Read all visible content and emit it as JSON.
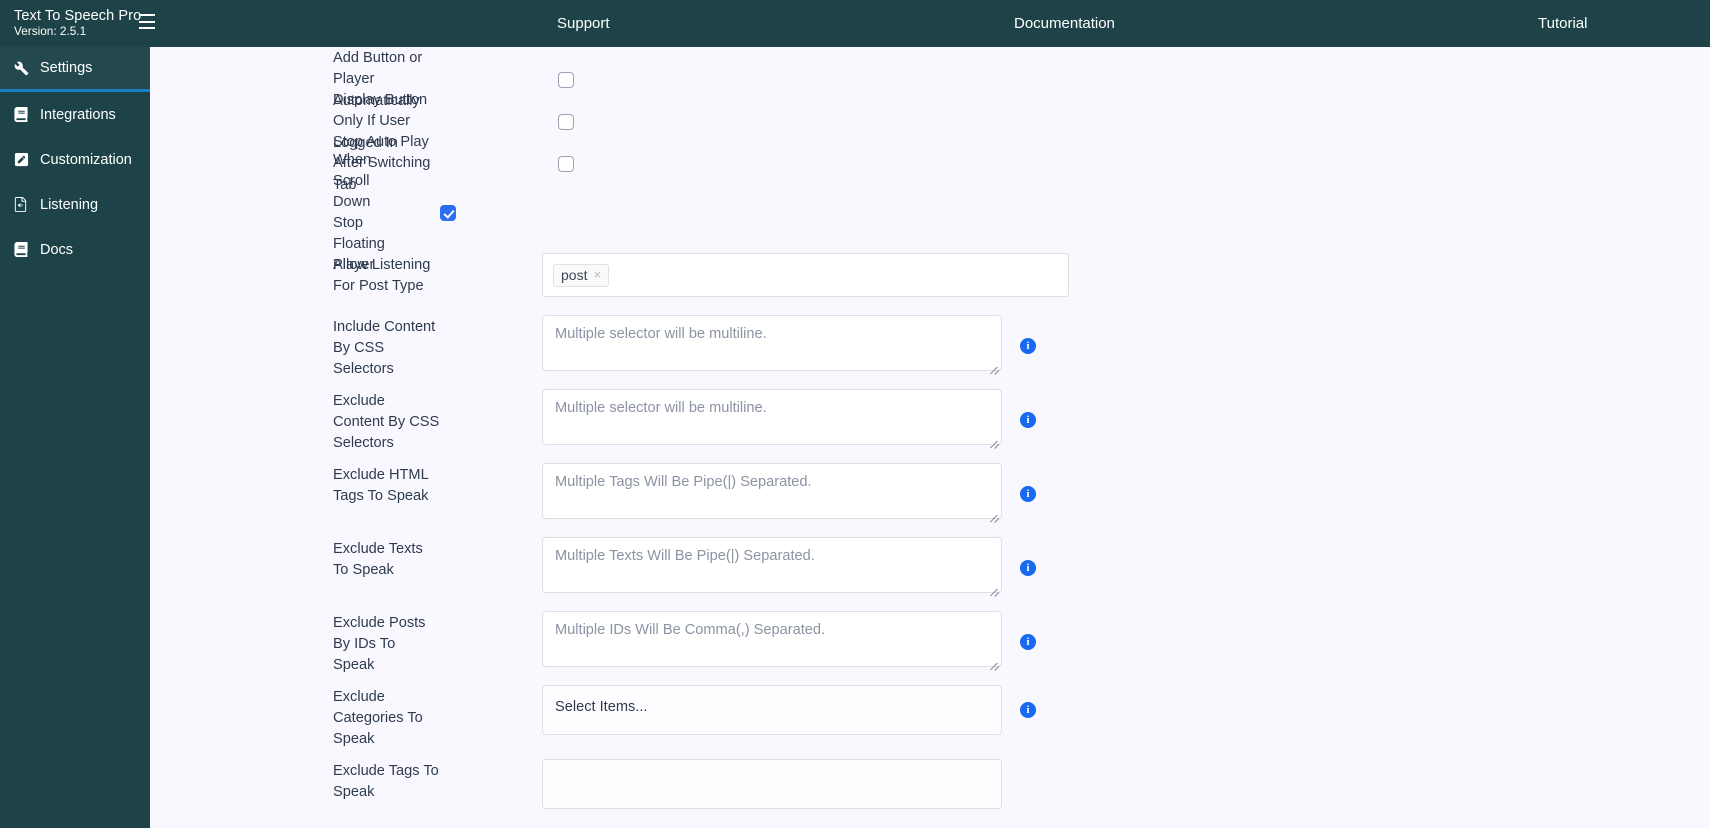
{
  "colors": {
    "sidebar_bg": "#1d4247",
    "sidebar_active_bg": "#23494e",
    "active_border": "#1a7fc1",
    "content_bg": "#f9f8ff",
    "checkbox_checked": "#2c6ef2",
    "info_icon": "#1769f0",
    "field_border": "#dcdfe6",
    "label_text": "#2e3b4e",
    "placeholder_text": "#8b93a3"
  },
  "brand": {
    "title": "Text To Speech Pro",
    "version": "Version: 2.5.1",
    "menu_icon": "hamburger-icon"
  },
  "topnav": {
    "links": [
      {
        "label": "Support"
      },
      {
        "label": "Documentation"
      },
      {
        "label": "Tutorial"
      }
    ]
  },
  "sidebar": {
    "items": [
      {
        "label": "Settings",
        "icon": "wrench-icon",
        "active": true
      },
      {
        "label": "Integrations",
        "icon": "book-icon",
        "active": false
      },
      {
        "label": "Customization",
        "icon": "pen-square-icon",
        "active": false
      },
      {
        "label": "Listening",
        "icon": "file-audio-icon",
        "active": false
      },
      {
        "label": "Docs",
        "icon": "book-icon",
        "active": false
      }
    ]
  },
  "settings": {
    "checkboxes": [
      {
        "label": "Add Button or Player Automatically",
        "checked": false
      },
      {
        "label": "Display Button Only If User Logged In",
        "checked": false
      },
      {
        "label": "Stop Auto Play After Switching Tab",
        "checked": false
      },
      {
        "label": "When Scroll Down Stop Floating Player",
        "checked": true
      }
    ],
    "post_type": {
      "label": "Allow Listening For Post Type",
      "tags": [
        {
          "text": "post",
          "remove": "×"
        }
      ]
    },
    "fields": [
      {
        "label": "Include Content By CSS Selectors",
        "placeholder": "Multiple selector will be multiline.",
        "value": "",
        "info": "i"
      },
      {
        "label": "Exclude Content By CSS Selectors",
        "placeholder": "Multiple selector will be multiline.",
        "value": "",
        "info": "i"
      },
      {
        "label": "Exclude HTML Tags To Speak",
        "placeholder": "Multiple Tags Will Be Pipe(|) Separated.",
        "value": "",
        "info": "i"
      },
      {
        "label": "Exclude Texts To Speak",
        "placeholder": "Multiple Texts Will Be Pipe(|) Separated.",
        "value": "",
        "info": "i"
      },
      {
        "label": "Exclude Posts By IDs To Speak",
        "placeholder": "Multiple IDs Will Be Comma(,) Separated.",
        "value": "",
        "info": "i"
      }
    ],
    "categories": {
      "label": "Exclude Categories To Speak",
      "placeholder": "Select Items...",
      "info": "i"
    },
    "tags_field": {
      "label": "Exclude Tags To Speak"
    }
  }
}
